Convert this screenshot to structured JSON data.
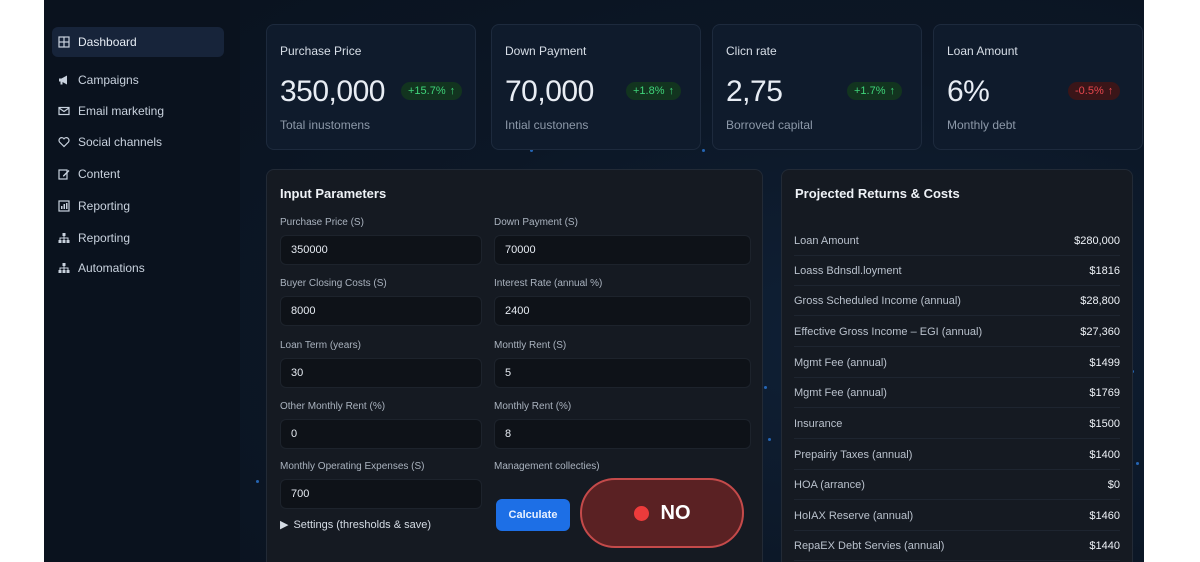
{
  "sidebar": {
    "items": [
      {
        "label": "Dashboard",
        "icon": "grid-icon",
        "active": true
      },
      {
        "label": "Campaigns",
        "icon": "megaphone-icon"
      },
      {
        "label": "Email marketing",
        "icon": "mail-icon"
      },
      {
        "label": "Social channels",
        "icon": "heart-icon"
      },
      {
        "label": "Content",
        "icon": "edit-icon"
      },
      {
        "label": "Reporting",
        "icon": "chart-icon"
      },
      {
        "label": "Reporting",
        "icon": "org-chart-icon"
      },
      {
        "label": "Automations",
        "icon": "org-chart-icon"
      }
    ]
  },
  "cards": [
    {
      "title": "Purchase Price",
      "value": "350,000",
      "badge": "+15.7%",
      "direction": "up",
      "sub": "Total inustomens"
    },
    {
      "title": "Down Payment",
      "value": "70,000",
      "badge": "+1.8%",
      "direction": "up",
      "sub": "Intial custonens"
    },
    {
      "title": "Clicn rate",
      "value": "2,75",
      "badge": "+1.7%",
      "direction": "up",
      "sub": "Borroved capital"
    },
    {
      "title": "Loan Amount",
      "value": "6%",
      "badge": "-0.5%",
      "direction": "down",
      "sub": "Monthly debt"
    }
  ],
  "input_panel": {
    "title": "Input Parameters",
    "fields": [
      {
        "label": "Purchase Price (S)",
        "value": "350000"
      },
      {
        "label": "Down Payment (S)",
        "value": "70000"
      },
      {
        "label": "Buyer Closing Costs (S)",
        "value": "8000"
      },
      {
        "label": "Interest Rate (annual %)",
        "value": "2400"
      },
      {
        "label": "Loan Term (years)",
        "value": "30"
      },
      {
        "label": "Monttly Rent (S)",
        "value": "5"
      },
      {
        "label": "Other Monthly Rent (%)",
        "value": "0"
      },
      {
        "label": "Monthly Rent (%)",
        "value": "8"
      },
      {
        "label": "Monthly Operating Expenses (S)",
        "value": "700"
      },
      {
        "label": "Management collecties)",
        "value": ""
      }
    ],
    "settings_label": "Settings (thresholds & save)",
    "calculate_label": "Calculate",
    "no_label": "NO"
  },
  "results_panel": {
    "title": "Projected Returns & Costs",
    "rows": [
      {
        "label": "Loan Amount",
        "value": "$280,000"
      },
      {
        "label": "Loass Bdnsdl.loyment",
        "value": "$1816"
      },
      {
        "label": "Gross Scheduled Income (annual)",
        "value": "$28,800"
      },
      {
        "label": "Effective Gross Income – EGI (annual)",
        "value": "$27,360"
      },
      {
        "label": "Mgmt Fee (annual)",
        "value": "$1499"
      },
      {
        "label": "Mgmt Fee (annual)",
        "value": "$1769"
      },
      {
        "label": "Insurance",
        "value": "$1500"
      },
      {
        "label": "Prepairiy Taxes (annual)",
        "value": "$1400"
      },
      {
        "label": "HOA (arrance)",
        "value": "$0"
      },
      {
        "label": "HoIAX Reserve (annual)",
        "value": "$1460"
      },
      {
        "label": "RepaEX Debt Servies (annual)",
        "value": "$1440"
      }
    ]
  },
  "colors": {
    "accent": "#1d6fe6",
    "positive": "#3fd47a",
    "negative": "#e8474e",
    "danger_button": "#5a2123"
  }
}
